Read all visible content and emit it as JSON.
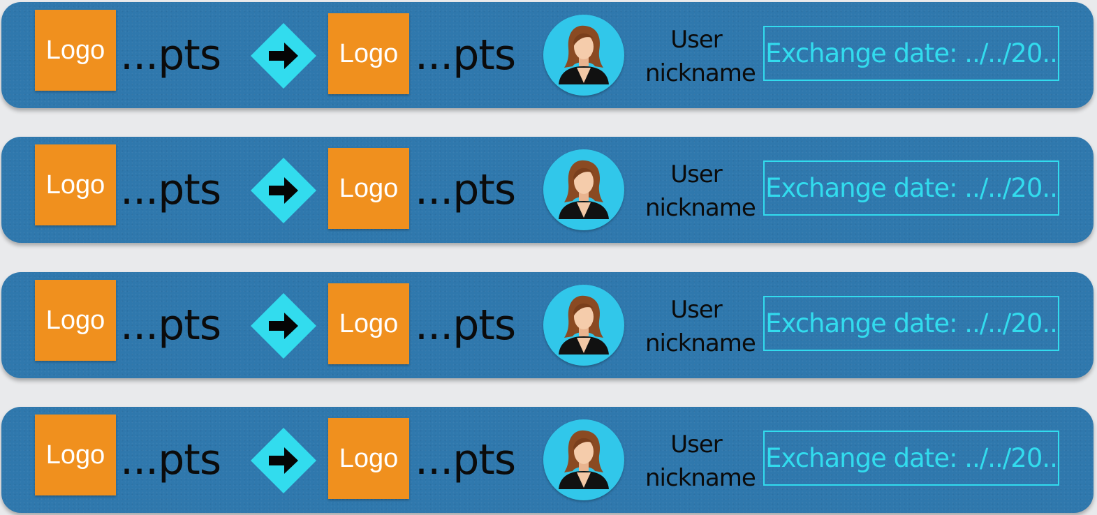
{
  "exchanges": [
    {
      "from_logo": "Logo",
      "from_points": "...pts",
      "to_logo": "Logo",
      "to_points": "...pts",
      "user_nickname_line1": "User",
      "user_nickname_line2": "nickname",
      "exchange_date": "Exchange date: ../../20.."
    },
    {
      "from_logo": "Logo",
      "from_points": "...pts",
      "to_logo": "Logo",
      "to_points": "...pts",
      "user_nickname_line1": "User",
      "user_nickname_line2": "nickname",
      "exchange_date": "Exchange date: ../../20.."
    },
    {
      "from_logo": "Logo",
      "from_points": "...pts",
      "to_logo": "Logo",
      "to_points": "...pts",
      "user_nickname_line1": "User",
      "user_nickname_line2": "nickname",
      "exchange_date": "Exchange date: ../../20.."
    },
    {
      "from_logo": "Logo",
      "from_points": "...pts",
      "to_logo": "Logo",
      "to_points": "...pts",
      "user_nickname_line1": "User",
      "user_nickname_line2": "nickname",
      "exchange_date": "Exchange date: ../../20.."
    }
  ],
  "icons": {
    "swap": "exchange-arrow-icon",
    "avatar": "female-user-avatar-icon"
  },
  "colors": {
    "page_background": "#e9eaec",
    "row_background": "#2f78ad",
    "logo": "#f0901e",
    "accent_cyan": "#32dcee",
    "avatar_background": "#31c7ea"
  }
}
